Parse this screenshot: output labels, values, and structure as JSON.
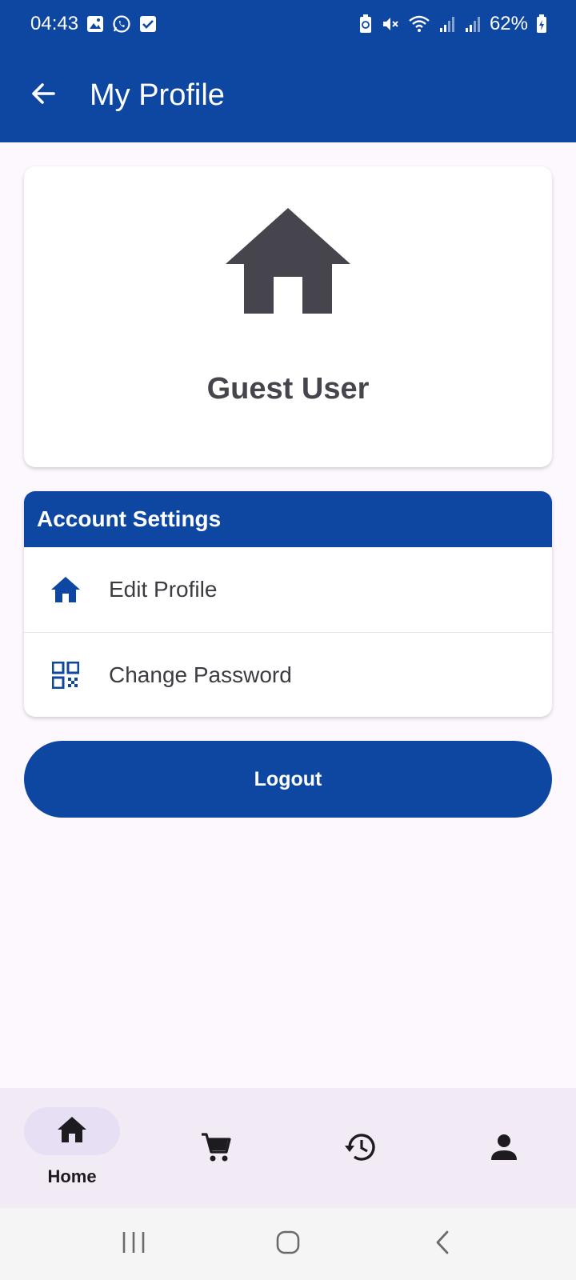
{
  "status_bar": {
    "time": "04:43",
    "battery": "62%",
    "left_icons": [
      "gallery-icon",
      "whatsapp-icon",
      "checkbox-icon"
    ],
    "right_icons": [
      "battery-saver-icon",
      "mute-icon",
      "wifi-icon",
      "signal-icon",
      "signal-icon",
      "battery-icon"
    ]
  },
  "app_bar": {
    "title": "My Profile",
    "back_icon": "arrow-back-icon"
  },
  "profile": {
    "name": "Guest User",
    "avatar_icon": "home-icon"
  },
  "account_settings": {
    "title": "Account Settings",
    "items": [
      {
        "label": "Edit Profile",
        "icon": "home-icon"
      },
      {
        "label": "Change Password",
        "icon": "qr-code-icon"
      }
    ]
  },
  "logout": {
    "label": "Logout"
  },
  "bottom_nav": {
    "items": [
      {
        "label": "Home",
        "icon": "home-icon",
        "active": true
      },
      {
        "label": "",
        "icon": "cart-icon",
        "active": false
      },
      {
        "label": "",
        "icon": "history-icon",
        "active": false
      },
      {
        "label": "",
        "icon": "person-icon",
        "active": false
      }
    ]
  },
  "colors": {
    "primary": "#0d47a1",
    "background": "#fdf7fe",
    "nav_background": "#f2eaf5",
    "nav_indicator": "#e7dff4",
    "icon_dark": "#46444c"
  }
}
